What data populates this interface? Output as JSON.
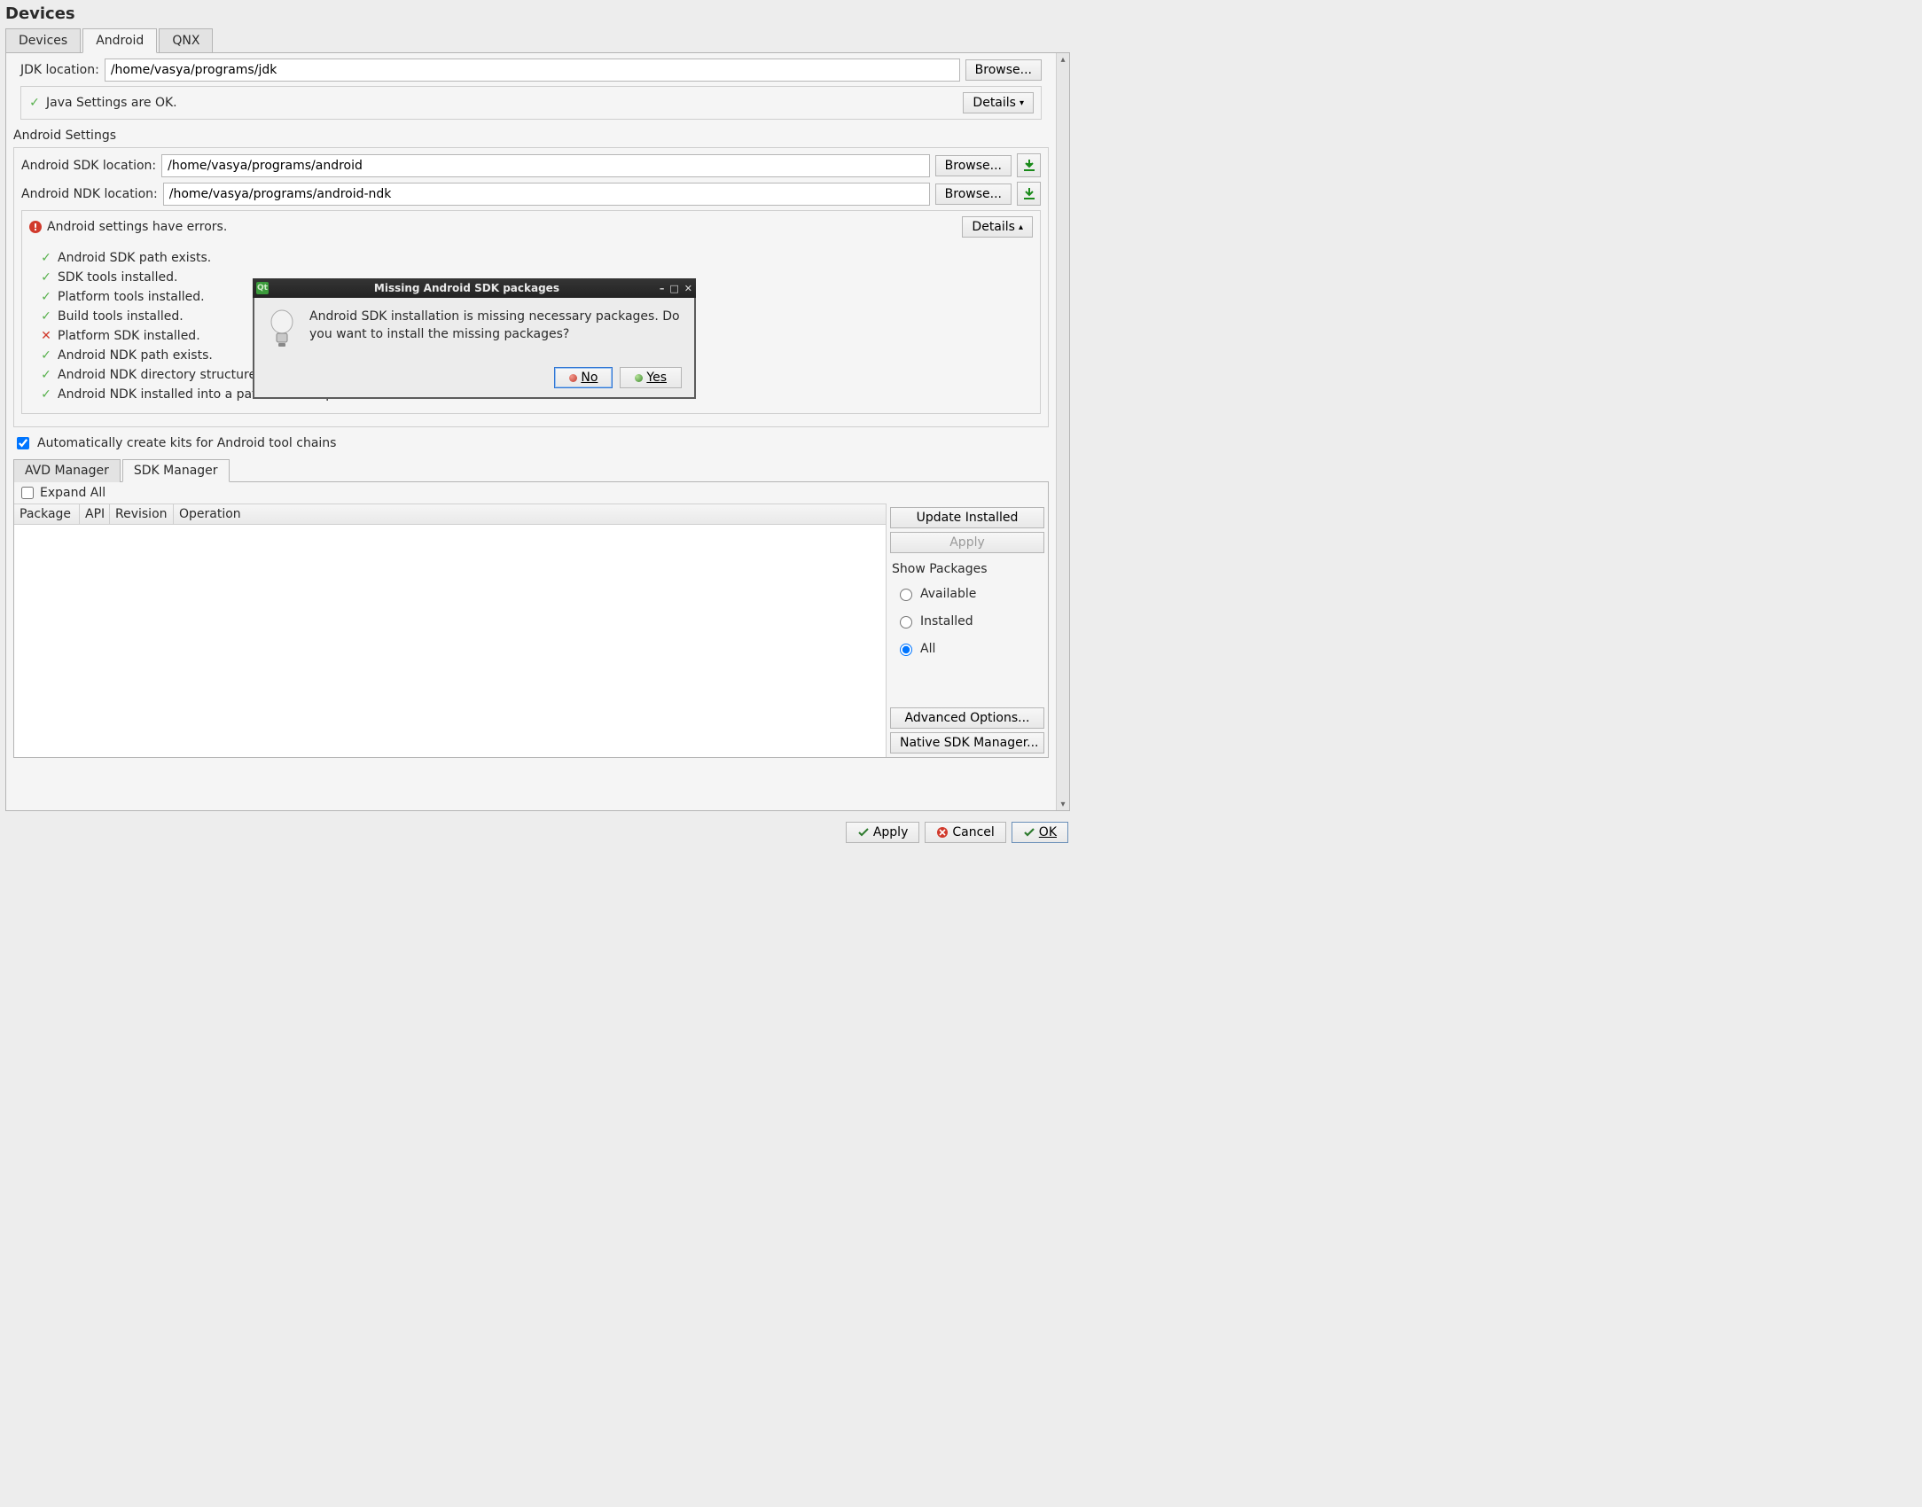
{
  "page_title": "Devices",
  "main_tabs": [
    "Devices",
    "Android",
    "QNX"
  ],
  "main_tab_active": 1,
  "jdk": {
    "label": "JDK location:",
    "value": "/home/vasya/programs/jdk",
    "browse": "Browse...",
    "status_text": "Java Settings are OK.",
    "details": "Details"
  },
  "android": {
    "section_label": "Android Settings",
    "sdk_label": "Android SDK location:",
    "sdk_value": "/home/vasya/programs/android",
    "ndk_label": "Android NDK location:",
    "ndk_value": "/home/vasya/programs/android-ndk",
    "browse": "Browse...",
    "error_text": "Android settings have errors.",
    "details": "Details",
    "checks": [
      {
        "ok": true,
        "text": "Android SDK path exists."
      },
      {
        "ok": true,
        "text": "SDK tools installed."
      },
      {
        "ok": true,
        "text": "Platform tools installed."
      },
      {
        "ok": true,
        "text": "Build tools installed."
      },
      {
        "ok": false,
        "text": "Platform SDK installed."
      },
      {
        "ok": true,
        "text": "Android NDK path exists."
      },
      {
        "ok": true,
        "text": "Android NDK directory structure is correct."
      },
      {
        "ok": true,
        "text": "Android NDK installed into a path without spaces."
      }
    ]
  },
  "auto_kits": {
    "checked": true,
    "label": "Automatically create kits for Android tool chains"
  },
  "managers": {
    "tabs": [
      "AVD Manager",
      "SDK Manager"
    ],
    "active": 1,
    "expand_all": {
      "checked": false,
      "label": "Expand All"
    },
    "columns": [
      "Package",
      "API",
      "Revision",
      "Operation"
    ],
    "side": {
      "update": "Update Installed",
      "apply": "Apply",
      "show_label": "Show Packages",
      "radios": [
        "Available",
        "Installed",
        "All"
      ],
      "radio_selected": 2,
      "advanced": "Advanced Options...",
      "native": "Native SDK Manager..."
    }
  },
  "footer": {
    "apply": "Apply",
    "cancel": "Cancel",
    "ok": "OK"
  },
  "modal": {
    "title": "Missing Android SDK packages",
    "message": "Android SDK installation is missing necessary packages. Do you want to install the missing packages?",
    "no": "No",
    "yes": "Yes"
  },
  "colors": {
    "ok_green": "#56b04b",
    "err_red": "#d13a2c",
    "dialog_blue": "#2e75d4"
  }
}
